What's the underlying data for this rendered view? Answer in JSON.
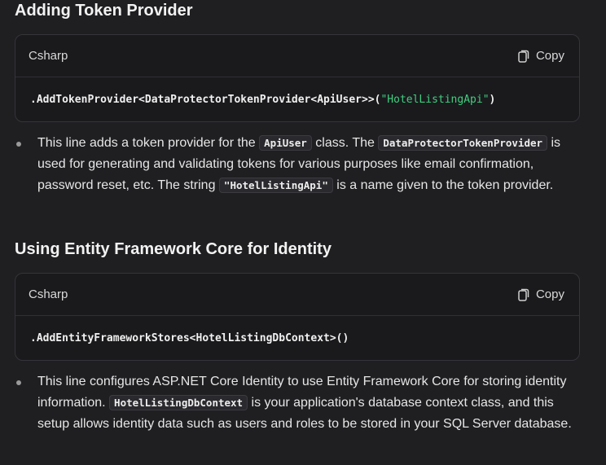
{
  "section1": {
    "heading": "Adding Token Provider",
    "code_block": {
      "language": "Csharp",
      "copy_label": "Copy",
      "code_prefix": ".AddTokenProvider<DataProtectorTokenProvider<ApiUser>>(",
      "code_string": "\"HotelListingApi\"",
      "code_suffix": ")"
    },
    "bullet": {
      "t1": "This line adds a token provider for the ",
      "c1": "ApiUser",
      "t2": " class. The ",
      "c2": "DataProtectorTokenProvider",
      "t3": " is used for generating and validating tokens for various purposes like email confirmation, password reset, etc. The string ",
      "c3": "\"HotelListingApi\"",
      "t4": " is a name given to the token provider."
    }
  },
  "section2": {
    "heading": "Using Entity Framework Core for Identity",
    "code_block": {
      "language": "Csharp",
      "copy_label": "Copy",
      "code": ".AddEntityFrameworkStores<HotelListingDbContext>()"
    },
    "bullet": {
      "t1": "This line configures ASP.NET Core Identity to use Entity Framework Core for storing identity information. ",
      "c1": "HotelListingDbContext",
      "t2": " is your application's database context class, and this setup allows identity data such as users and roles to be stored in your SQL Server database."
    }
  },
  "icons": {
    "copy": "copy-icon"
  },
  "colors": {
    "background": "#1f1f22",
    "code_background": "#1a1a1d",
    "string_literal": "#3fcf7f"
  }
}
